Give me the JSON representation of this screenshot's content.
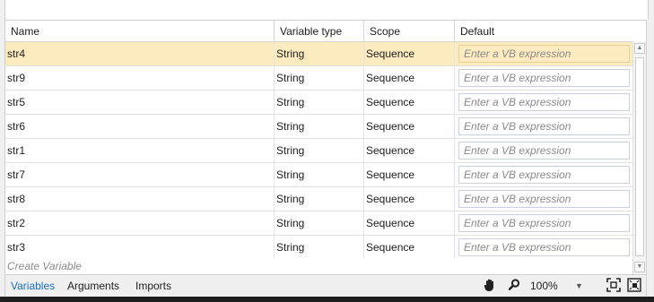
{
  "columns": {
    "name": "Name",
    "variable_type": "Variable type",
    "scope": "Scope",
    "default": "Default"
  },
  "rows": [
    {
      "name": "str4",
      "type": "String",
      "scope": "Sequence",
      "default_placeholder": "Enter a VB expression",
      "selected": true
    },
    {
      "name": "str9",
      "type": "String",
      "scope": "Sequence",
      "default_placeholder": "Enter a VB expression"
    },
    {
      "name": "str5",
      "type": "String",
      "scope": "Sequence",
      "default_placeholder": "Enter a VB expression"
    },
    {
      "name": "str6",
      "type": "String",
      "scope": "Sequence",
      "default_placeholder": "Enter a VB expression"
    },
    {
      "name": "str1",
      "type": "String",
      "scope": "Sequence",
      "default_placeholder": "Enter a VB expression"
    },
    {
      "name": "str7",
      "type": "String",
      "scope": "Sequence",
      "default_placeholder": "Enter a VB expression"
    },
    {
      "name": "str8",
      "type": "String",
      "scope": "Sequence",
      "default_placeholder": "Enter a VB expression"
    },
    {
      "name": "str2",
      "type": "String",
      "scope": "Sequence",
      "default_placeholder": "Enter a VB expression"
    },
    {
      "name": "str3",
      "type": "String",
      "scope": "Sequence",
      "default_placeholder": "Enter a VB expression"
    }
  ],
  "create_variable": "Create Variable",
  "bottom_tabs": {
    "variables": "Variables",
    "arguments": "Arguments",
    "imports": "Imports"
  },
  "zoom": {
    "value": "100%"
  },
  "icons": {
    "hand": "hand-icon",
    "search": "search-icon",
    "fit": "fit-to-screen-icon",
    "overview": "overview-icon"
  },
  "colors": {
    "selected_row": "#fdebc0",
    "active_tab": "#1a6fc4"
  }
}
